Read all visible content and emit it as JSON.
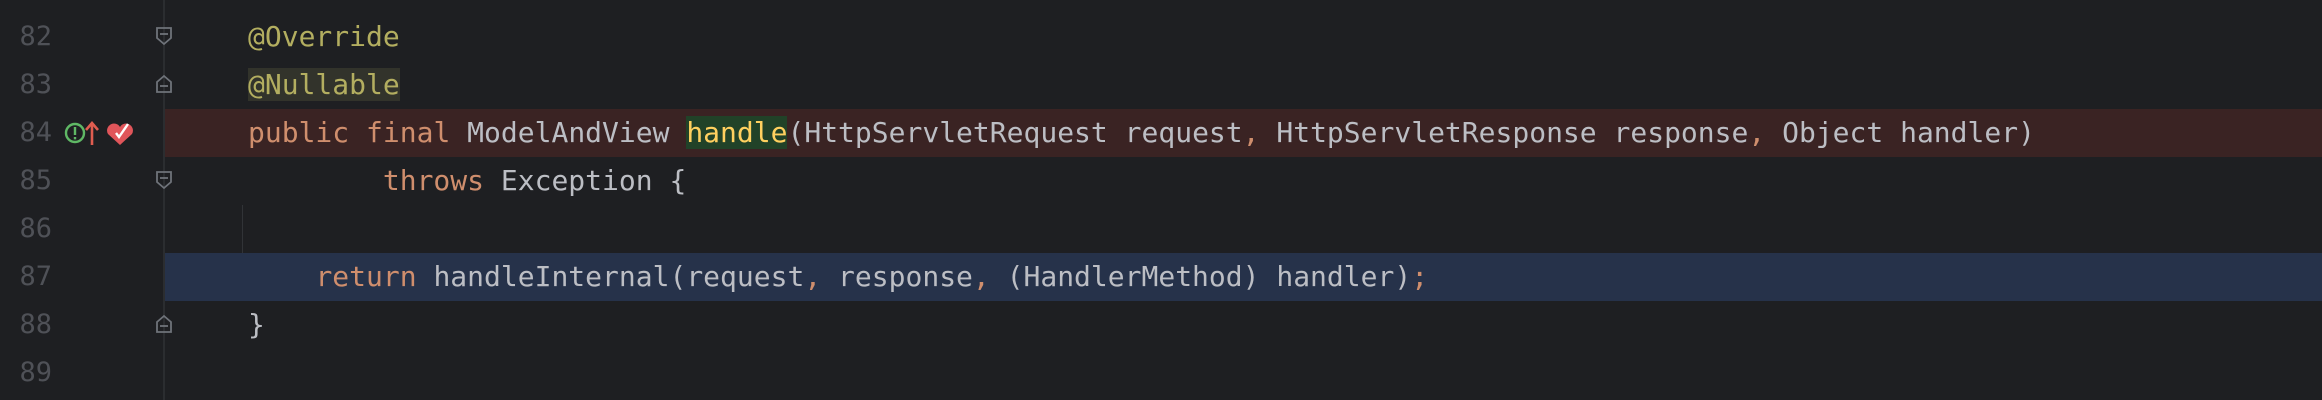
{
  "editor": {
    "line_numbers": [
      "82",
      "83",
      "84",
      "85",
      "86",
      "87",
      "88",
      "89"
    ],
    "lines": {
      "l82": {
        "annotation": "@Override"
      },
      "l83": {
        "annotation": "@Nullable"
      },
      "l84": {
        "kw_public": "public",
        "kw_final": "final",
        "return_type": "ModelAndView",
        "method_name": "handle",
        "params_1": "(HttpServletRequest request",
        "comma_1": ",",
        "params_2": " HttpServletResponse response",
        "comma_2": ",",
        "params_3": " Object handler)"
      },
      "l85": {
        "kw_throws": "throws",
        "exception": " Exception {"
      },
      "l87": {
        "kw_return": "return",
        "call_1": " handleInternal(request",
        "comma_1": ",",
        "call_2": " response",
        "comma_2": ",",
        "call_3": " (HandlerMethod) handler)",
        "semicolon": ";"
      },
      "l88": {
        "brace": "}"
      }
    },
    "gutter_icons": [
      "implementing-method-icon",
      "override-arrow-icon",
      "breakpoint-icon"
    ],
    "colors": {
      "background": "#1e1f22",
      "keyword": "#cf8e6d",
      "annotation": "#b3ae60",
      "text": "#bcbec4",
      "method_highlight_bg": "#214228",
      "method_highlight_fg": "#ffd05f",
      "breakpoint_line_bg": "#3a2323",
      "current_line_bg": "#26324a",
      "line_number": "#4f5157"
    }
  }
}
